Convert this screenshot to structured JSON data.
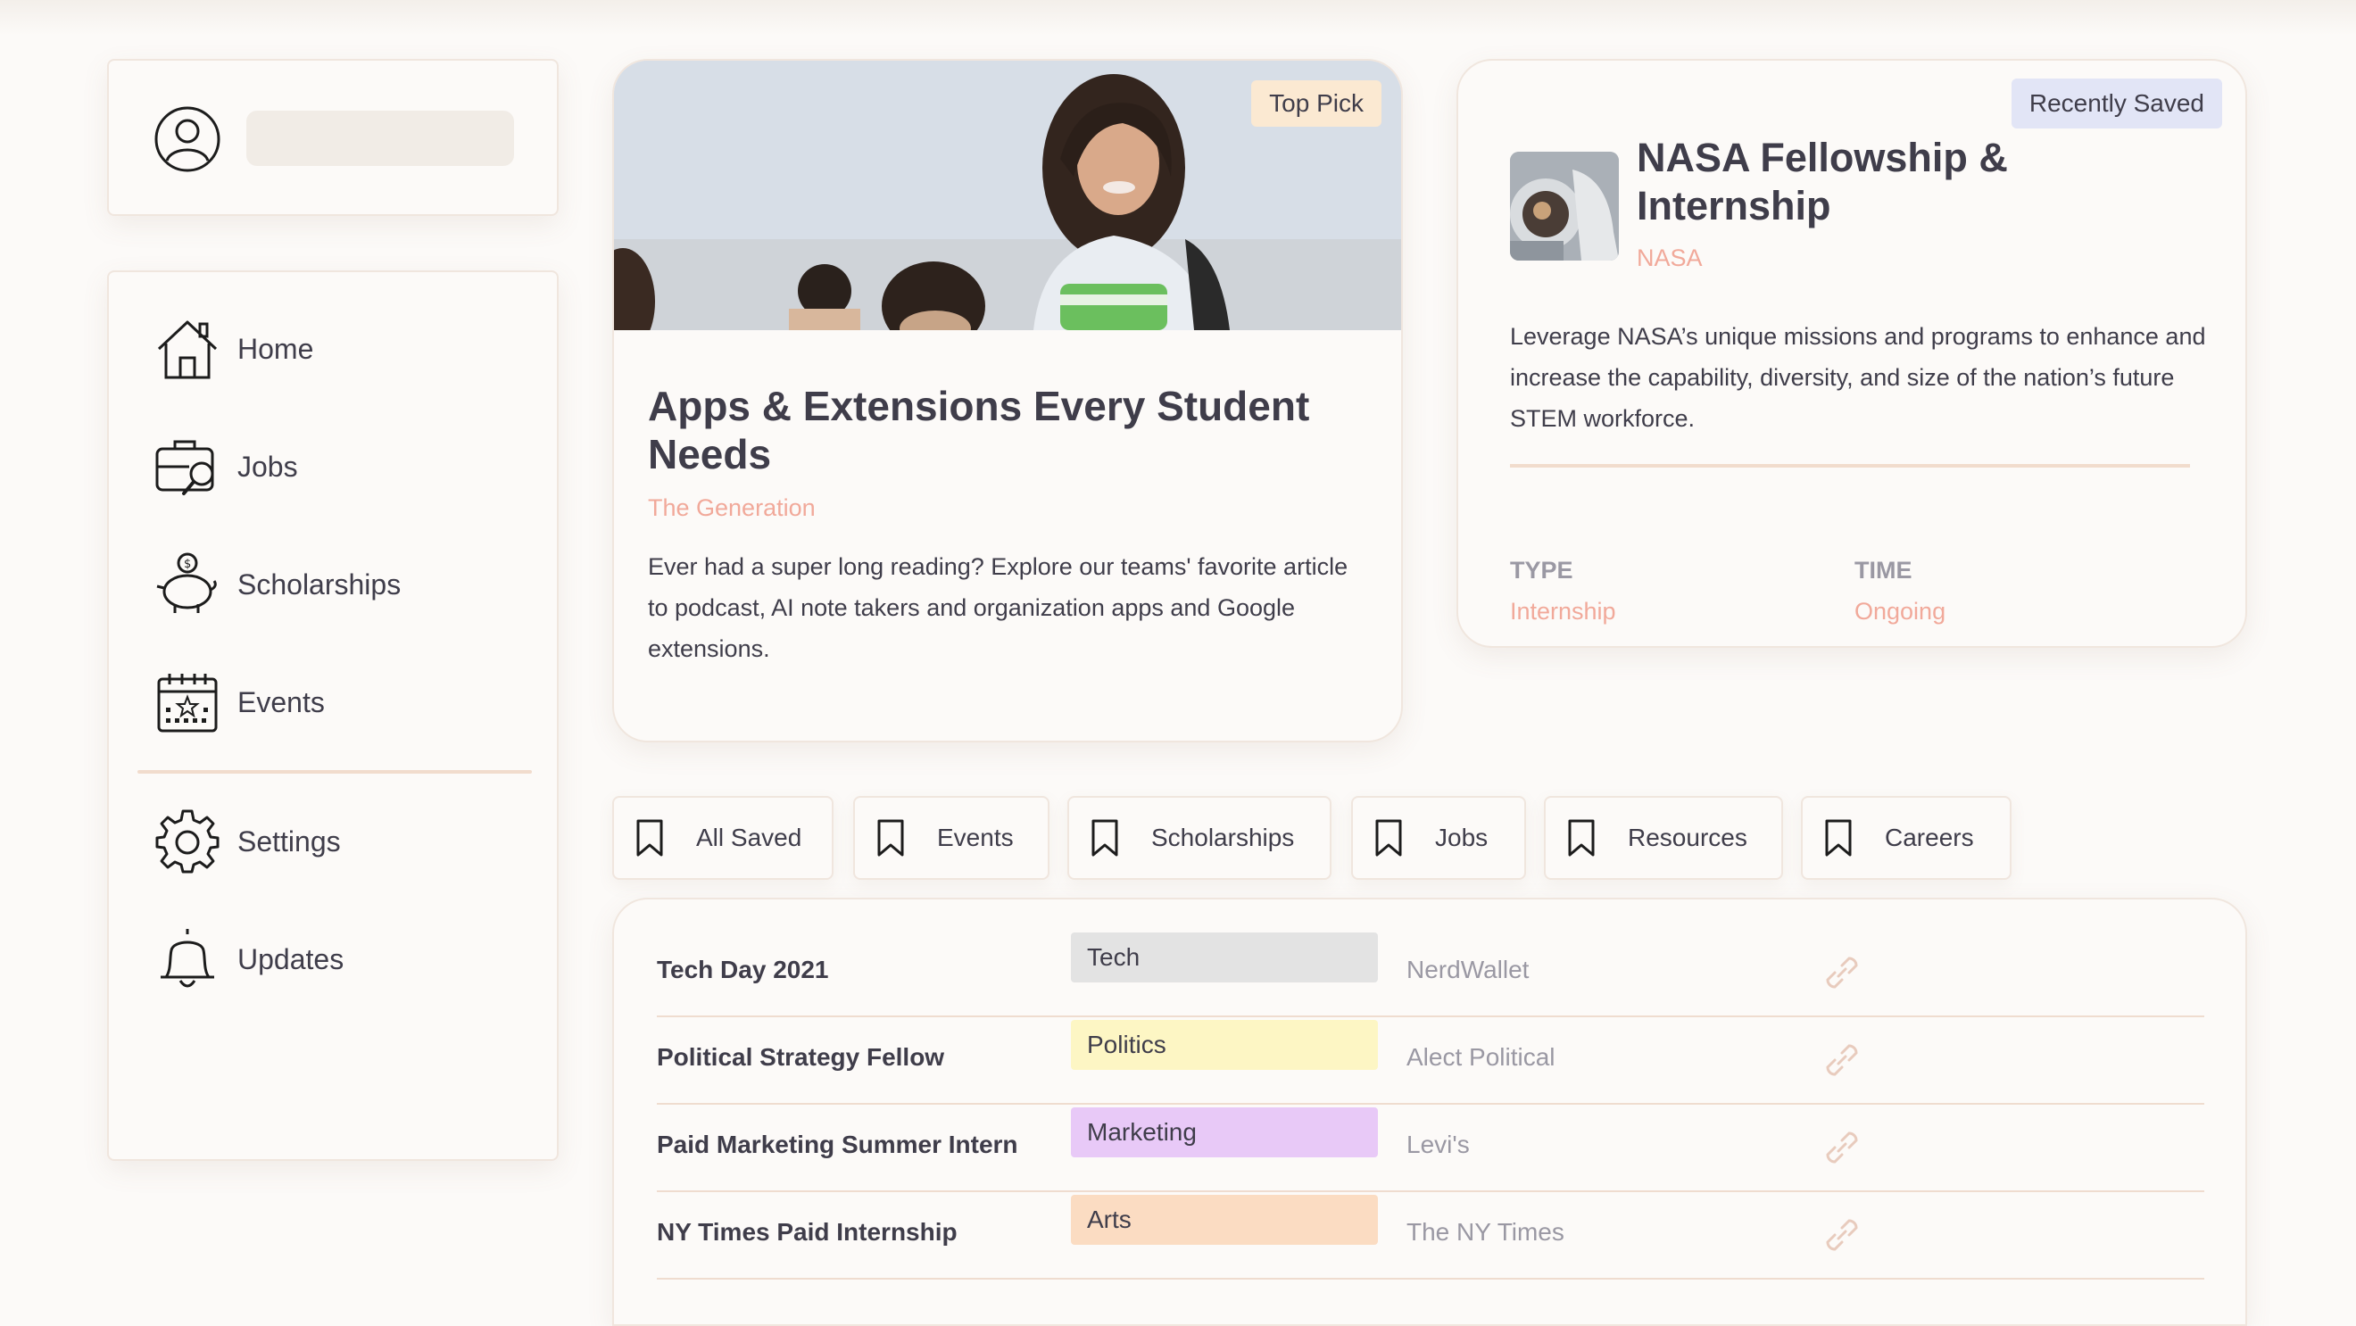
{
  "profile": {
    "avatar_icon": "user-circle-icon"
  },
  "nav": {
    "items": [
      {
        "label": "Home",
        "icon": "home-icon"
      },
      {
        "label": "Jobs",
        "icon": "briefcase-icon"
      },
      {
        "label": "Scholarships",
        "icon": "piggy-bank-icon"
      },
      {
        "label": "Events",
        "icon": "calendar-icon"
      },
      {
        "label": "Settings",
        "icon": "gear-icon"
      },
      {
        "label": "Updates",
        "icon": "bell-icon"
      }
    ]
  },
  "feature": {
    "badge": "Top Pick",
    "title": "Apps & Extensions Every Student Needs",
    "source": "The Generation",
    "description": "Ever had a super long reading? Explore our teams' favorite article to podcast, AI note takers and organization apps and Google extensions."
  },
  "saved": {
    "badge": "Recently Saved",
    "title": "NASA Fellowship & Internship",
    "org": "NASA",
    "description": "Leverage NASA’s unique missions and programs to enhance and increase the capability, diversity, and size of the nation’s future STEM workforce.",
    "type_label": "TYPE",
    "type_value": "Internship",
    "time_label": "TIME",
    "time_value": "Ongoing"
  },
  "tabs": [
    "All Saved",
    "Events",
    "Scholarships",
    "Jobs",
    "Resources",
    "Careers"
  ],
  "table": {
    "rows": [
      {
        "name": "Tech Day 2021",
        "tag": "Tech",
        "tag_color": "#e3e3e3",
        "org": "NerdWallet"
      },
      {
        "name": "Political Strategy Fellow",
        "tag": "Politics",
        "tag_color": "#fdf6c4",
        "org": "Alect Political"
      },
      {
        "name": "Paid Marketing Summer Intern",
        "tag": "Marketing",
        "tag_color": "#e8c9f7",
        "org": "Levi's"
      },
      {
        "name": "NY Times Paid Internship",
        "tag": "Arts",
        "tag_color": "#fbdcc2",
        "org": "The NY Times"
      }
    ]
  },
  "colors": {
    "accent": "#f1a99a",
    "divider": "#f1dccd",
    "text": "#3f3d4a",
    "muted": "#9a98a3"
  }
}
